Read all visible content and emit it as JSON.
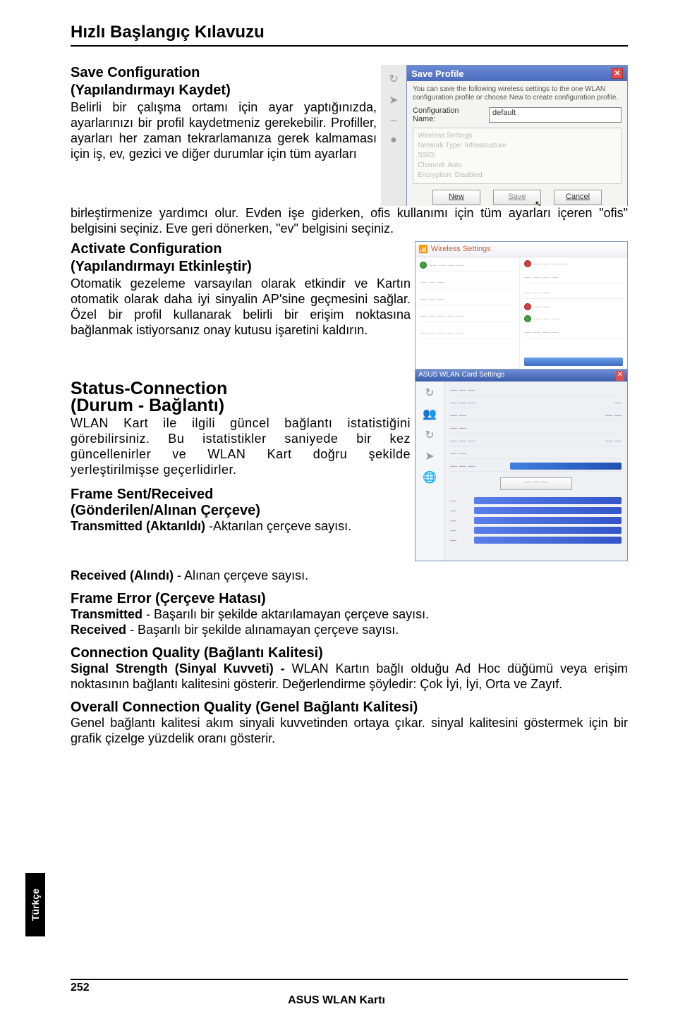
{
  "header": {
    "title": "Hızlı Başlangıç Kılavuzu"
  },
  "saveConfig": {
    "heading1": "Save Configuration",
    "heading2": "(Yapılandırmayı Kaydet)",
    "para1": "Belirli bir çalışma ortamı için ayar yaptığınızda, ayarlarınızı bir profil kaydetmeniz gerekebilir. Profiller, ayarları her zaman tekrarlamanıza gerek kalmaması için iş, ev, gezici ve diğer durumlar için tüm ayarları",
    "paraFull": "birleştirmenize yardımcı olur. Evden işe giderken, ofis kullanımı için tüm ayarları içeren \"ofis\" belgisini seçiniz. Eve geri dönerken, \"ev\" belgisini seçiniz."
  },
  "saveProfileDialog": {
    "title": "Save Profile",
    "desc": "You can save the following wireless settings to the one WLAN configuration profile or choose New to create configuration profile.",
    "nameLabel": "Configuration Name:",
    "nameValue": "default",
    "settings": {
      "head": "Wireless Settings",
      "nt": "Network Type:     Infrastructure",
      "ssid": "SSID:",
      "ch": "Channel:           Auto",
      "en": "Encryption:        Disabled"
    },
    "btnNew": "New",
    "btnSave": "Save",
    "btnCancel": "Cancel"
  },
  "activate": {
    "heading1": "Activate Configuration",
    "heading2": "(Yapılandırmayı Etkinleştir)",
    "para": "Otomatik gezeleme varsayılan olarak etkindir ve Kartın otomatik olarak daha iyi sinyalin AP'sine geçmesini sağlar. Özel bir profil kullanarak belirli bir erişim noktasına bağlanmak istiyorsanız onay kutusu işaretini kaldırın."
  },
  "activateImg": {
    "title": "Wireless Settings"
  },
  "status": {
    "heading1": "Status-Connection",
    "heading2": "(Durum - Bağlantı)",
    "para": "WLAN Kart ile ilgili güncel bağlantı istatistiğini görebilirsiniz. Bu istatistikler saniyede bir kez güncellenirler ve WLAN Kart doğru şekilde yerleştirilmişse geçerlidirler."
  },
  "statusImg": {
    "title": "ASUS WLAN Card Settings"
  },
  "frameSR": {
    "heading1": "Frame Sent/Received",
    "heading2": "(Gönderilen/Alınan Çerçeve)",
    "line1bold": "Transmitted (Aktarıldı)",
    "line1rest": " -Aktarılan çerçeve sayısı.",
    "line2bold": "Received (Alındı)",
    "line2rest": " - Alınan çerçeve sayısı."
  },
  "frameErr": {
    "heading": "Frame Error (Çerçeve Hatası)",
    "l1b": "Transmitted",
    "l1r": " - Başarılı bir şekilde aktarılamayan çerçeve sayısı.",
    "l2b": "Received",
    "l2r": " - Başarılı bir şekilde alınamayan çerçeve sayısı."
  },
  "connQ": {
    "heading": "Connection Quality (Bağlantı Kalitesi)",
    "lb": "Signal Strength (Sinyal Kuvveti) -",
    "rest": " WLAN Kartın bağlı olduğu Ad Hoc düğümü veya erişim noktasının bağlantı kalitesini gösterir. Değerlendirme şöyledir: Çok İyi, İyi, Orta ve Zayıf."
  },
  "overall": {
    "heading": "Overall Connection Quality (Genel Bağlantı Kalitesi)",
    "para": "Genel bağlantı kalitesi akım sinyali kuvvetinden ortaya çıkar. sinyal kalitesini göstermek için bir grafik çizelge yüzdelik oranı gösterir."
  },
  "sidetab": "Türkçe",
  "footer": {
    "page": "252",
    "center": "ASUS WLAN Kartı"
  }
}
